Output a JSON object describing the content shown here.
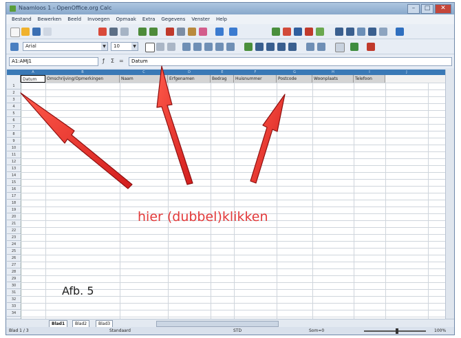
{
  "window": {
    "title": "Naamloos 1 - OpenOffice.org Calc"
  },
  "menu": [
    "Bestand",
    "Bewerken",
    "Beeld",
    "Invoegen",
    "Opmaak",
    "Extra",
    "Gegevens",
    "Venster",
    "Help"
  ],
  "toolbar2": {
    "font_name": "Arial",
    "font_size": "10"
  },
  "formula_bar": {
    "name_box": "A1:AMJ1",
    "input_value": "Datum"
  },
  "columns": [
    "A",
    "B",
    "C",
    "D",
    "E",
    "F",
    "G",
    "H",
    "I",
    "J"
  ],
  "field_headers": [
    "Datum",
    "Omschrijving/Opmerkingen",
    "Naam",
    "Erfgenamen",
    "Bedrag",
    "Huisnummer",
    "Postcode",
    "Woonplaats",
    "Telefoon"
  ],
  "rows": [
    "1",
    "2",
    "3",
    "4",
    "5",
    "6",
    "7",
    "8",
    "9",
    "10",
    "11",
    "12",
    "13",
    "14",
    "15",
    "16",
    "17",
    "18",
    "19",
    "20",
    "21",
    "22",
    "23",
    "24",
    "25",
    "26",
    "27",
    "28",
    "29",
    "30",
    "31",
    "32",
    "33",
    "34"
  ],
  "sheet_tabs": [
    "Blad1",
    "Blad2",
    "Blad3"
  ],
  "status": {
    "sheet": "Blad 1 / 3",
    "style": "Standaard",
    "mode": "STD",
    "sum": "Som=0",
    "zoom": "100%"
  },
  "annotation": {
    "text": "hier (dubbel)klikken",
    "color": "#e33a3a"
  },
  "figure_label": "Afb. 5"
}
